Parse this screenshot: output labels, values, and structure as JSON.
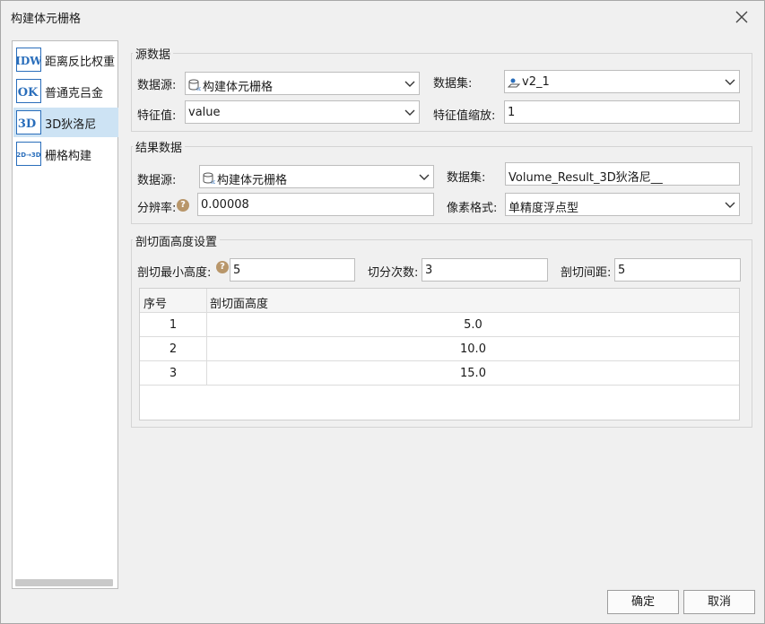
{
  "window": {
    "title": "构建体元栅格"
  },
  "nav": {
    "items": [
      {
        "icon_text": "IDW",
        "label": "距离反比权重"
      },
      {
        "icon_text": "OK",
        "label": "普通克吕金"
      },
      {
        "icon_text": "3D",
        "label": "3D狄洛尼"
      },
      {
        "icon_text": "2D→3D",
        "label": "栅格构建"
      }
    ],
    "selected_index": 2
  },
  "source": {
    "title": "源数据",
    "datasource_label": "数据源:",
    "datasource_value": "构建体元栅格",
    "dataset_label": "数据集:",
    "dataset_value": "v2_1",
    "feature_label": "特征值:",
    "feature_value": "value",
    "scale_label": "特征值缩放:",
    "scale_value": "1"
  },
  "result": {
    "title": "结果数据",
    "datasource_label": "数据源:",
    "datasource_value": "构建体元栅格",
    "dataset_label": "数据集:",
    "dataset_value": "Volume_Result_3D狄洛尼__",
    "resolution_label": "分辨率:",
    "resolution_value": "0.00008",
    "pixel_label": "像素格式:",
    "pixel_value": "单精度浮点型"
  },
  "section": {
    "title": "剖切面高度设置",
    "min_label": "剖切最小高度:",
    "min_value": "5",
    "count_label": "切分次数:",
    "count_value": "3",
    "interval_label": "剖切间距:",
    "interval_value": "5",
    "columns": [
      "序号",
      "剖切面高度"
    ],
    "rows": [
      {
        "no": "1",
        "height": "5.0"
      },
      {
        "no": "2",
        "height": "10.0"
      },
      {
        "no": "3",
        "height": "15.0"
      }
    ]
  },
  "footer": {
    "ok": "确定",
    "cancel": "取消"
  },
  "colors": {
    "selected": "#cde3f4",
    "icon_blue": "#2a6ebb",
    "help": "#b8966a"
  }
}
